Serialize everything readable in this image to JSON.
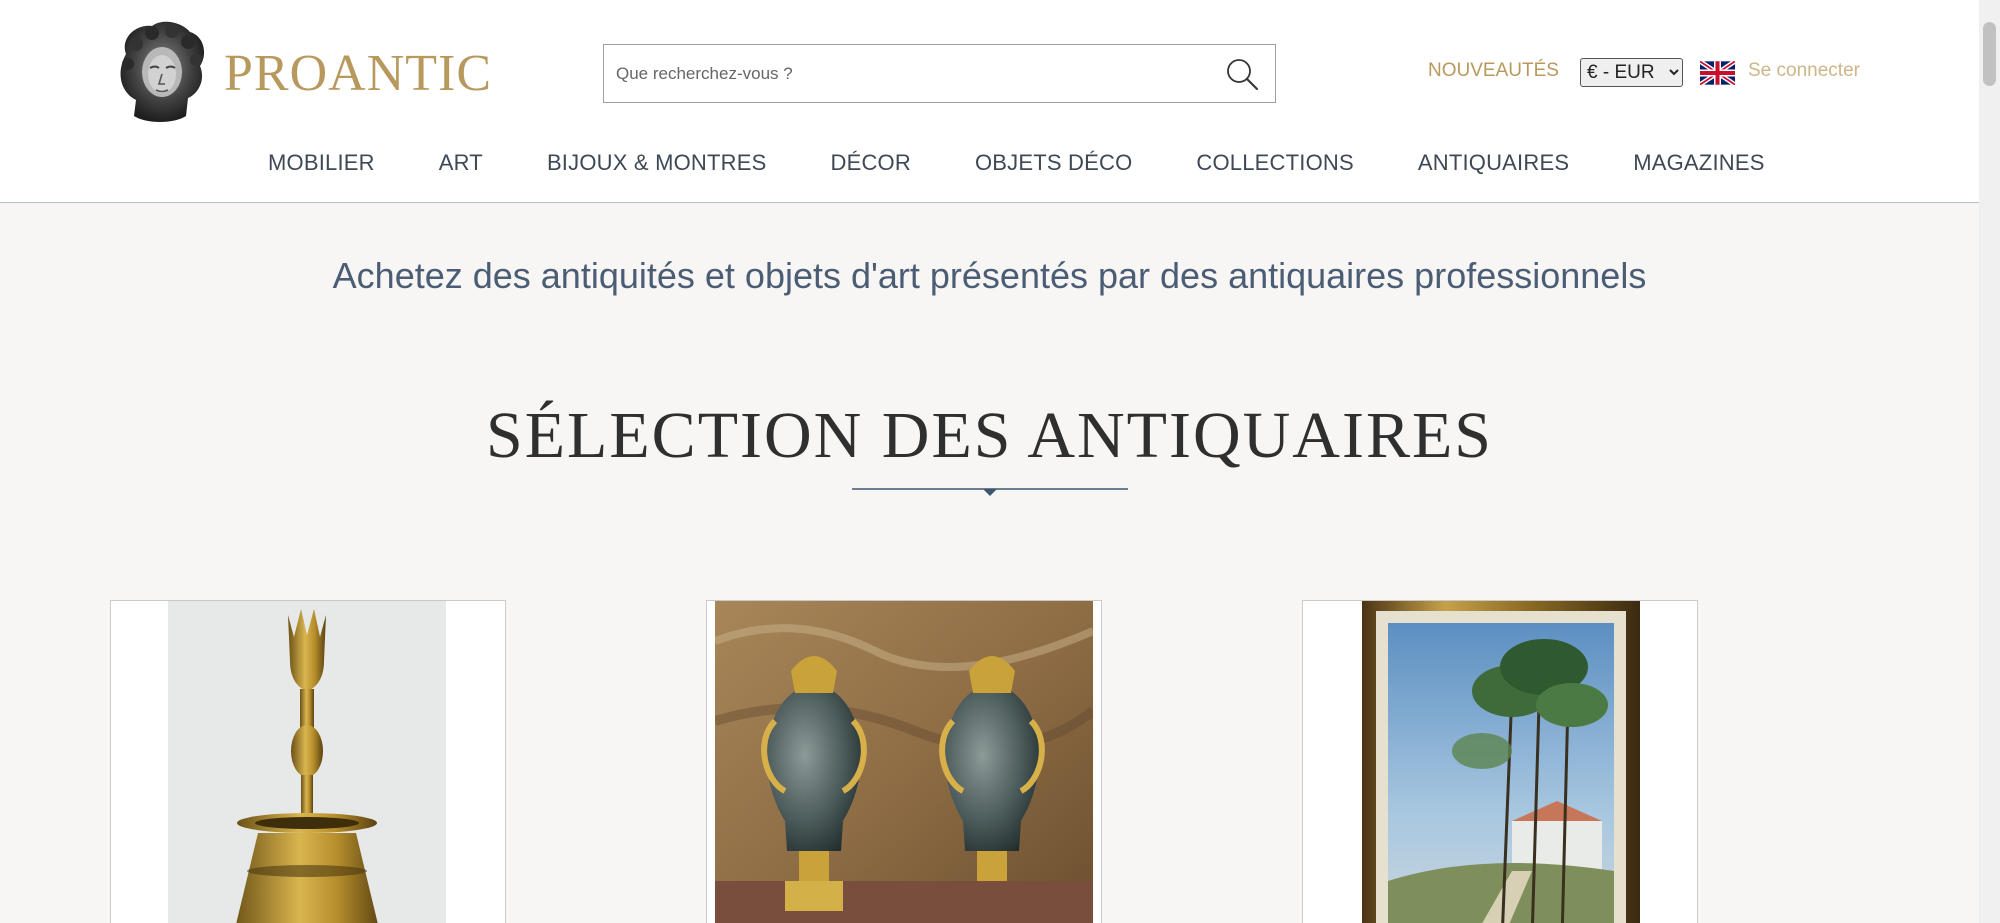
{
  "header": {
    "logo_text": "PROANTIC",
    "search": {
      "placeholder": "Que recherchez-vous ?"
    },
    "nouveautes": "NOUVEAUTÉS",
    "currency": {
      "options": [
        "€ - EUR"
      ]
    },
    "login": "Se connecter"
  },
  "nav": {
    "items": [
      {
        "label": "MOBILIER"
      },
      {
        "label": "ART"
      },
      {
        "label": "BIJOUX & MONTRES"
      },
      {
        "label": "DÉCOR"
      },
      {
        "label": "OBJETS DÉCO"
      },
      {
        "label": "COLLECTIONS"
      },
      {
        "label": "ANTIQUAIRES"
      },
      {
        "label": "MAGAZINES"
      }
    ]
  },
  "main": {
    "tagline": "Achetez des antiquités et objets d'art présentés par des antiquaires professionnels",
    "section_title": "SÉLECTION DES ANTIQUAIRES"
  },
  "colors": {
    "brand_gold": "#b8995d",
    "login_gold": "#cdb589",
    "nav_text": "#3e4955",
    "tagline_blue": "#4b5d74",
    "page_background": "#f7f6f4"
  },
  "icons": [
    "search-icon",
    "uk-flag-icon"
  ]
}
